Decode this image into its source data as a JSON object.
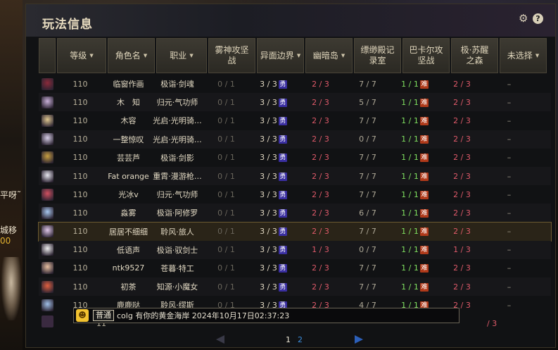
{
  "window": {
    "title": "玩法信息"
  },
  "left_strip": {
    "frag1": "平呀˜男",
    "frag2": "城移",
    "frag3": "00"
  },
  "columns": [
    {
      "label": "等级",
      "sort": true
    },
    {
      "label": "角色名",
      "sort": true
    },
    {
      "label": "职业",
      "sort": true
    },
    {
      "label": "雾神攻坚战",
      "sort": false
    },
    {
      "label": "异面边界",
      "sort": true
    },
    {
      "label": "幽暗岛",
      "sort": true
    },
    {
      "label": "缥缈殿记录室",
      "sort": false
    },
    {
      "label": "巴卡尔攻坚战",
      "sort": false
    },
    {
      "label": "极·苏醒之森",
      "sort": false
    },
    {
      "label": "未选择",
      "sort": true
    }
  ],
  "rows": [
    {
      "level": "110",
      "name": "临窗作画",
      "job": "极诣·剑魂",
      "d1": "0 / 1",
      "d2": "3 / 3",
      "d3": "2 / 3",
      "d4": "7 / 7",
      "d5": "1 / 1",
      "d6": "2 / 3",
      "d7": "–",
      "avatar_color": "#8a2a3a"
    },
    {
      "level": "110",
      "name": "木　知",
      "job": "归元·气功师",
      "d1": "0 / 1",
      "d2": "3 / 3",
      "d3": "2 / 3",
      "d4": "5 / 7",
      "d5": "1 / 1",
      "d6": "2 / 3",
      "d7": "–",
      "avatar_color": "#c8b0d8"
    },
    {
      "level": "110",
      "name": "木容",
      "job": "光启·光明骑…",
      "d1": "0 / 1",
      "d2": "3 / 3",
      "d3": "2 / 3",
      "d4": "7 / 7",
      "d5": "1 / 1",
      "d6": "2 / 3",
      "d7": "–",
      "avatar_color": "#e0c890"
    },
    {
      "level": "110",
      "name": "一整惊叹",
      "job": "光启·光明骑…",
      "d1": "0 / 1",
      "d2": "3 / 3",
      "d3": "2 / 3",
      "d4": "0 / 7",
      "d5": "1 / 1",
      "d6": "2 / 3",
      "d7": "–",
      "avatar_color": "#d8d0e8"
    },
    {
      "level": "110",
      "name": "芸芸芦",
      "job": "极诣·剑影",
      "d1": "0 / 1",
      "d2": "3 / 3",
      "d3": "2 / 3",
      "d4": "7 / 7",
      "d5": "1 / 1",
      "d6": "2 / 3",
      "d7": "–",
      "avatar_color": "#c8a040"
    },
    {
      "level": "110",
      "name": "Fat orange",
      "job": "重霄·漫游枪…",
      "d1": "0 / 1",
      "d2": "3 / 3",
      "d3": "2 / 3",
      "d4": "7 / 7",
      "d5": "1 / 1",
      "d6": "2 / 3",
      "d7": "–",
      "avatar_color": "#e8e8f0"
    },
    {
      "level": "110",
      "name": "光冰v",
      "job": "归元·气功师",
      "d1": "0 / 1",
      "d2": "3 / 3",
      "d3": "2 / 3",
      "d4": "7 / 7",
      "d5": "1 / 1",
      "d6": "2 / 3",
      "d7": "–",
      "avatar_color": "#d05060"
    },
    {
      "level": "110",
      "name": "淼雾",
      "job": "极诣·阿修罗",
      "d1": "0 / 1",
      "d2": "3 / 3",
      "d3": "2 / 3",
      "d4": "6 / 7",
      "d5": "1 / 1",
      "d6": "2 / 3",
      "d7": "–",
      "avatar_color": "#a8c8f0"
    },
    {
      "level": "110",
      "name": "居居不细细",
      "job": "聆风·旅人",
      "d1": "0 / 1",
      "d2": "3 / 3",
      "d3": "2 / 3",
      "d4": "7 / 7",
      "d5": "1 / 1",
      "d6": "2 / 3",
      "d7": "–",
      "avatar_color": "#e0c8e8"
    },
    {
      "level": "110",
      "name": "低语声",
      "job": "极诣·驭剑士",
      "d1": "0 / 1",
      "d2": "3 / 3",
      "d3": "1 / 3",
      "d4": "0 / 7",
      "d5": "1 / 1",
      "d6": "1 / 3",
      "d7": "–",
      "avatar_color": "#f0f0f0"
    },
    {
      "level": "110",
      "name": "ntk9527",
      "job": "苍暮·特工",
      "d1": "0 / 1",
      "d2": "3 / 3",
      "d3": "2 / 3",
      "d4": "7 / 7",
      "d5": "1 / 1",
      "d6": "2 / 3",
      "d7": "–",
      "avatar_color": "#e8c0a0"
    },
    {
      "level": "110",
      "name": "初茶",
      "job": "知源·小魔女",
      "d1": "0 / 1",
      "d2": "3 / 3",
      "d3": "2 / 3",
      "d4": "7 / 7",
      "d5": "1 / 1",
      "d6": "2 / 3",
      "d7": "–",
      "avatar_color": "#e06040"
    },
    {
      "level": "110",
      "name": "鹿鹿哒",
      "job": "聆风·缪斯",
      "d1": "0 / 1",
      "d2": "3 / 3",
      "d3": "2 / 3",
      "d4": "4 / 7",
      "d5": "1 / 1",
      "d6": "2 / 3",
      "d7": "–",
      "avatar_color": "#a0c0e8"
    }
  ],
  "tags": {
    "yong": "勇",
    "nan": "难"
  },
  "partial_row": {
    "level": "11",
    "d6": "/ 3"
  },
  "chat": {
    "emoji": "☻",
    "channel": "普通",
    "message": "colg 有你的黄金海岸 2024年10月17日02:37:23"
  },
  "pager": {
    "page1": "1",
    "page2": "2"
  },
  "icons": {
    "gear": "⚙",
    "help": "?"
  },
  "colors": {
    "red_value": "#e05a6a",
    "green_value": "#7fe060",
    "yong_tag": "#3a2fa0",
    "nan_tag": "#b03a1a",
    "selected_row": "#2a2418"
  },
  "selected_row_index": 8
}
